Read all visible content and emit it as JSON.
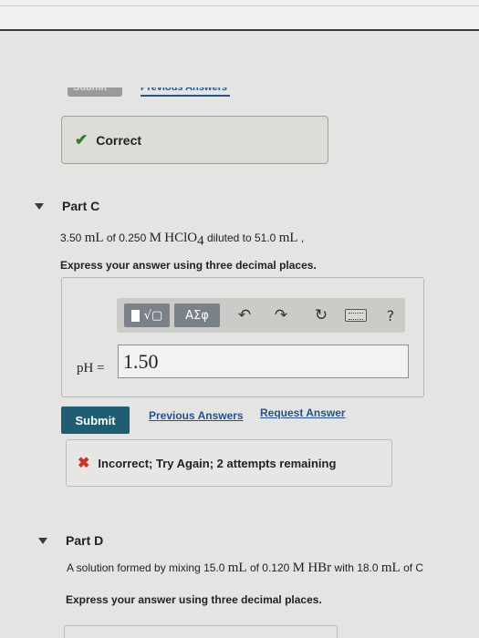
{
  "previous_attempt": {
    "submit_label": "Submit",
    "previous_answers_label": "Previous Answers"
  },
  "part_b_feedback": {
    "text": "Correct"
  },
  "part_c": {
    "title": "Part C",
    "question": {
      "pre": "3.50 ",
      "u1": "mL",
      "mid1": " of 0.250 ",
      "molar": "M",
      "formula": "HClO",
      "sub": "4",
      "mid2": " diluted to 51.0 ",
      "u2": "mL",
      "post": " ,"
    },
    "instruction": "Express your answer using three decimal places.",
    "toolbar": {
      "greek": "ΑΣφ",
      "help": "?"
    },
    "answer_label": "pH =",
    "answer_value": "1.50",
    "submit_label": "Submit",
    "previous_answers_label": "Previous Answers",
    "request_answer_label": "Request Answer",
    "feedback": "Incorrect; Try Again; 2 attempts remaining"
  },
  "part_d": {
    "title": "Part D",
    "question": {
      "pre": "A solution formed by mixing 15.0 ",
      "u1": "mL",
      "mid1": " of 0.120 ",
      "molar": "M",
      "formula": "HBr",
      "mid2": " with 18.0 ",
      "u2": "mL",
      "post": " of C"
    },
    "instruction": "Express your answer using three decimal places."
  }
}
